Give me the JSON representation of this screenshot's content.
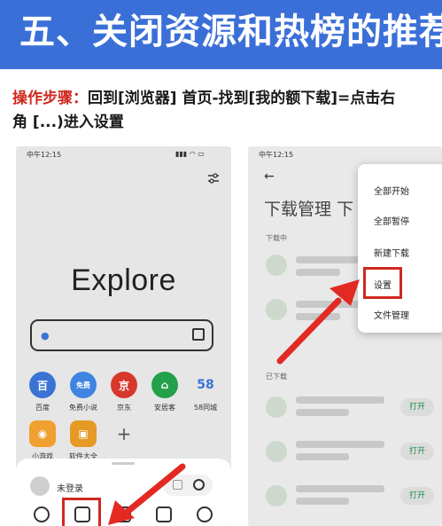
{
  "banner": {
    "title": "五、关闭资源和热榜的推荐"
  },
  "instructions": {
    "label": "操作步骤：",
    "text_line1": "回到[浏览器] 首页-找到[我的额下载]=点击右",
    "text_line2": "角 [...)进入设置"
  },
  "phone1": {
    "status_time": "中午12:15",
    "explore_text": "Explore",
    "apps": [
      {
        "label": "百度",
        "color": "#3a73d4",
        "glyph": "🐾"
      },
      {
        "label": "免费小说",
        "color": "#3f84e0",
        "glyph": "免费"
      },
      {
        "label": "京东",
        "color": "#d8372c",
        "glyph": "🐶"
      },
      {
        "label": "安居客",
        "color": "#23a04a",
        "glyph": "⌂"
      },
      {
        "label": "58同城",
        "color": "#e6e6e6",
        "glyph": "58"
      },
      {
        "label": "小游戏",
        "color": "#f0a030",
        "glyph": "🎮"
      },
      {
        "label": "软件大全",
        "color": "#e59a25",
        "glyph": "🛍"
      },
      {
        "label": "",
        "color": "#e6e6e6",
        "glyph": "+"
      }
    ],
    "login_text": "未登录"
  },
  "phone2": {
    "status_time": "中午12:15",
    "page_title": "下载管理",
    "page_title_tail": "下",
    "section_downloading": "下载中",
    "section_downloaded": "已下载",
    "open_label": "打开",
    "menu_items": [
      "全部开始",
      "全部暂停",
      "新建下载",
      "设置",
      "文件管理"
    ]
  }
}
